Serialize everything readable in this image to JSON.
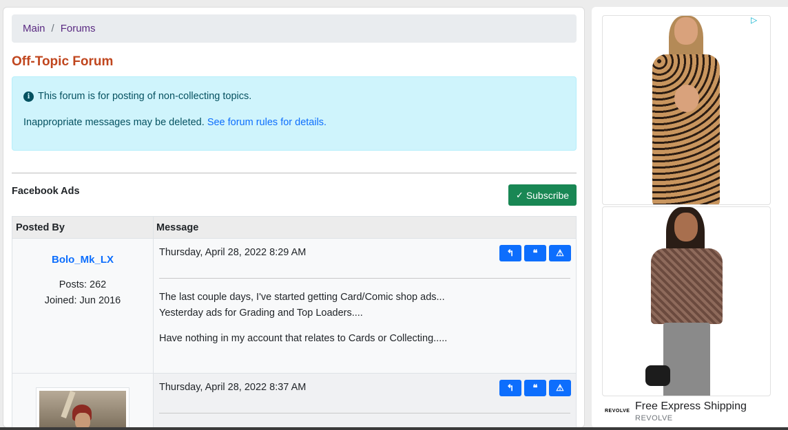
{
  "breadcrumb": {
    "items": [
      "Main",
      "Forums"
    ],
    "separator": "/"
  },
  "forum": {
    "title": "Off-Topic Forum"
  },
  "info": {
    "icon": "info-circle-icon",
    "line1": "This forum is for posting of non-collecting topics.",
    "line2": "Inappropriate messages may be deleted.",
    "link": "See forum rules for details."
  },
  "topic": {
    "title": "Facebook Ads",
    "subscribe_label": "Subscribe"
  },
  "table": {
    "headers": {
      "posted_by": "Posted By",
      "message": "Message"
    },
    "posts": [
      {
        "author": "Bolo_Mk_LX",
        "posts": "Posts: 262",
        "joined": "Joined: Jun 2016",
        "date": "Thursday, April 28, 2022 8:29 AM",
        "body": [
          "The last couple days, I've started getting Card/Comic shop ads...",
          "Yesterday ads for Grading and Top Loaders....",
          "Have nothing in my account that relates to Cards or Collecting....."
        ]
      },
      {
        "date": "Thursday, April 28, 2022 8:37 AM"
      }
    ],
    "action_icons": [
      "reply-icon",
      "quote-icon",
      "report-icon"
    ]
  },
  "ad": {
    "caption": "Free Express Shipping",
    "brand": "REVOLVE",
    "logo_text": "REVOLVE"
  },
  "colors": {
    "title": "#c0461e",
    "link": "#0d6efd",
    "breadcrumb_link": "#5a2a82",
    "subscribe": "#198754",
    "info_bg": "#cff4fc"
  }
}
